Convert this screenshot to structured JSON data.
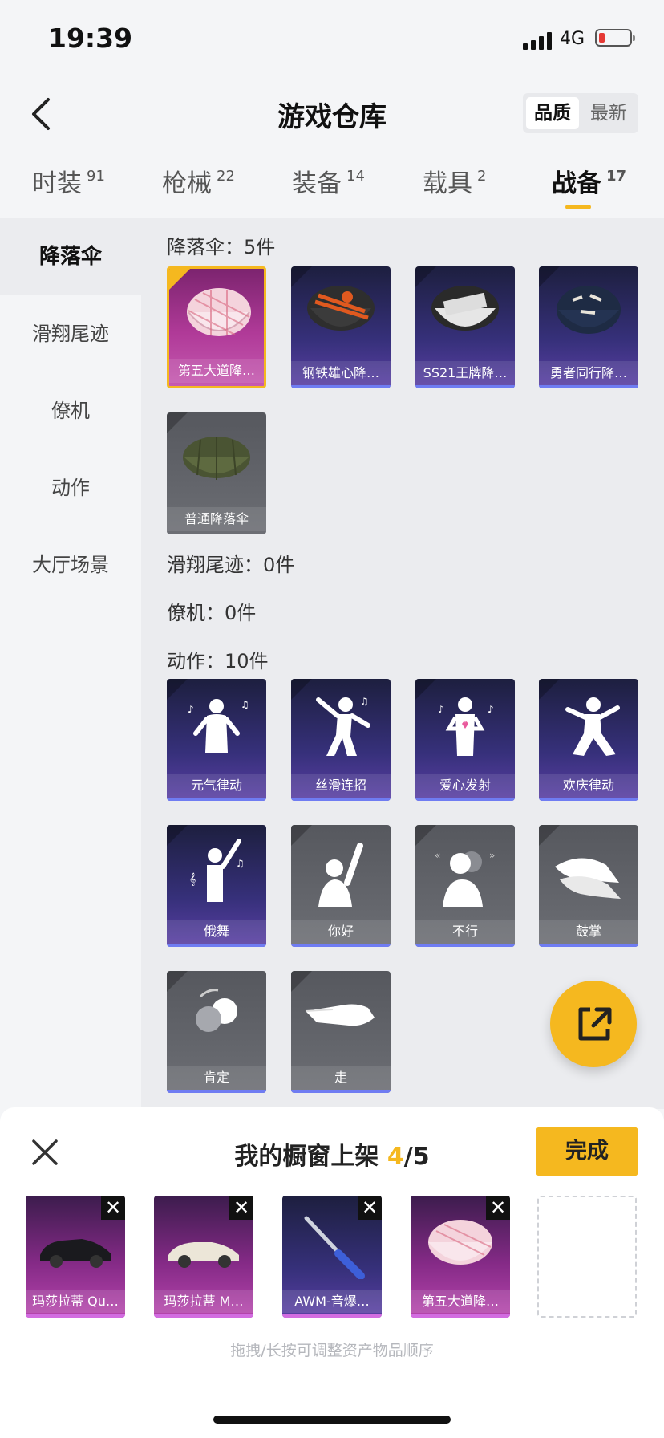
{
  "status_bar": {
    "time": "19:39",
    "network": "4G"
  },
  "header": {
    "title": "游戏仓库",
    "sort_options": [
      "品质",
      "最新"
    ],
    "sort_selected": "品质"
  },
  "tabs": [
    {
      "label": "时装",
      "count": "91"
    },
    {
      "label": "枪械",
      "count": "22"
    },
    {
      "label": "装备",
      "count": "14"
    },
    {
      "label": "载具",
      "count": "2"
    },
    {
      "label": "战备",
      "count": "17"
    }
  ],
  "sidebar": {
    "items": [
      "降落伞",
      "滑翔尾迹",
      "僚机",
      "动作",
      "大厅场景"
    ],
    "selected": "降落伞"
  },
  "sections": {
    "parachute": {
      "title": "降落伞：5件",
      "items": [
        "第五大道降…",
        "钢铁雄心降…",
        "SS21王牌降…",
        "勇者同行降…",
        "普通降落伞"
      ]
    },
    "trail": {
      "title": "滑翔尾迹：0件"
    },
    "wingman": {
      "title": "僚机：0件"
    },
    "emote": {
      "title": "动作：10件",
      "items": [
        "元气律动",
        "丝滑连招",
        "爱心发射",
        "欢庆律动",
        "俄舞",
        "你好",
        "不行",
        "鼓掌",
        "肯定",
        "走"
      ]
    }
  },
  "showcase": {
    "title": "我的橱窗上架",
    "count": "4",
    "total": "/5",
    "done_label": "完成",
    "items": [
      "玛莎拉蒂 Qu…",
      "玛莎拉蒂 M…",
      "AWM-音爆…",
      "第五大道降…"
    ],
    "remove_glyph": "✕",
    "hint": "拖拽/长按可调整资产物品顺序"
  },
  "colors": {
    "accent": "#f5b81f",
    "card_purple": "#36307a",
    "card_gold_border": "#f5b81f",
    "card_gray": "#6c6e74",
    "bar_blue": "#6f7cf2"
  }
}
